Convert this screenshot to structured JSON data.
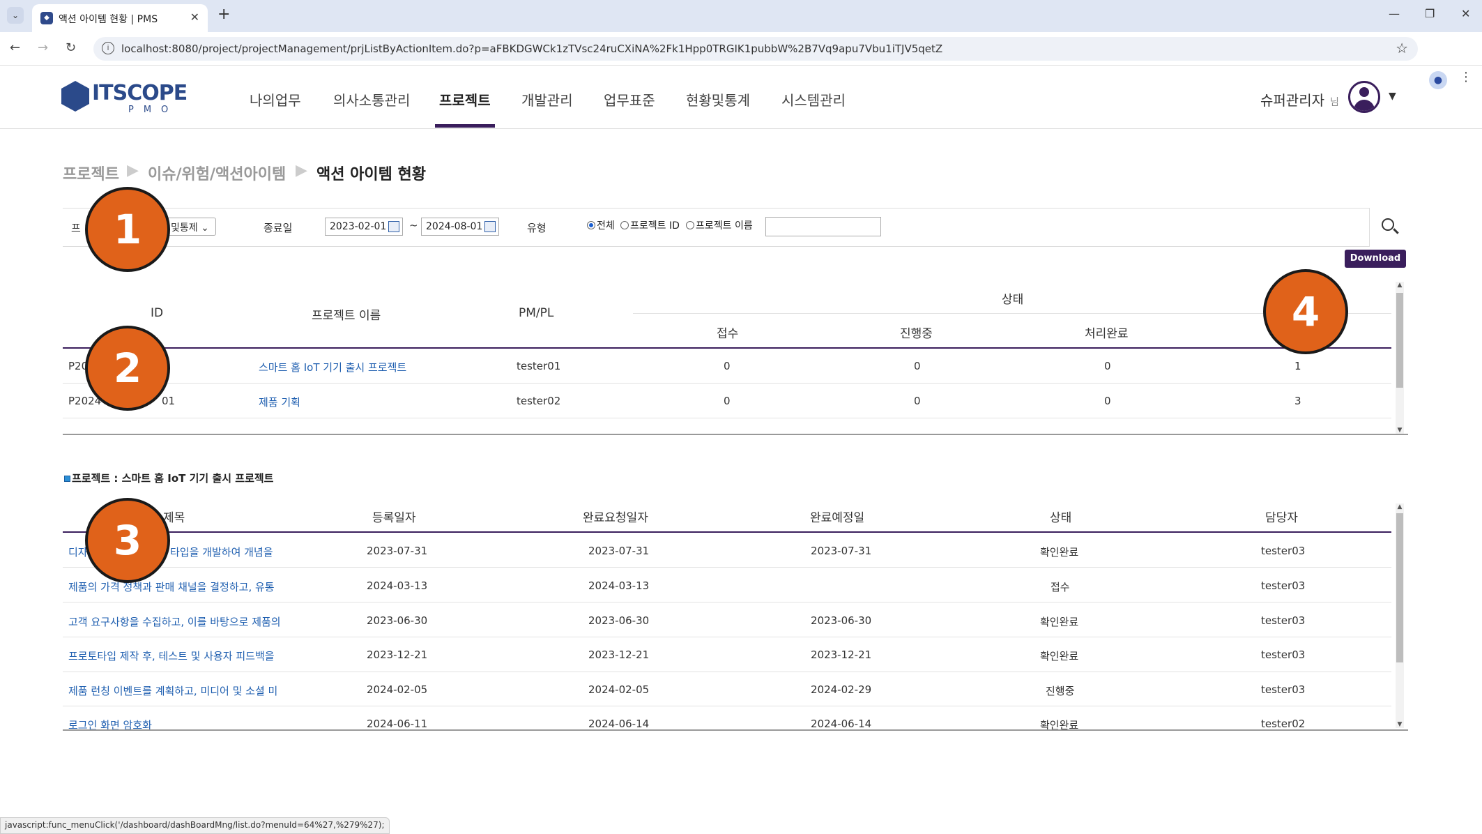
{
  "browser": {
    "tab_title": "액션 아이템 현황 | PMS",
    "url": "localhost:8080/project/projectManagement/prjListByActionItem.do?p=aFBKDGWCk1zTVsc24ruCXiNA%2Fk1Hpp0TRGIK1pubbW%2B7Vq9apu7Vbu1iTJV5qetZ",
    "status_url": "javascript:func_menuClick('/dashboard/dashBoardMng/list.do?menuId=64%27,%279%27);"
  },
  "header": {
    "logo_text": "ITSCOPE",
    "logo_sub": "PMO",
    "menu": [
      "나의업무",
      "의사소통관리",
      "프로젝트",
      "개발관리",
      "업무표준",
      "현황및통계",
      "시스템관리"
    ],
    "active_menu": "프로젝트",
    "user_name": "슈퍼관리자",
    "user_suffix": "님"
  },
  "breadcrumb": [
    "프로젝트",
    "이슈/위험/액션아이템",
    "액션 아이템 현황"
  ],
  "filter": {
    "project_label": "프",
    "project_select": "및통제",
    "end_date_label": "종료일",
    "date_from": "2023-02-01",
    "date_sep": "~",
    "date_to": "2024-08-01",
    "type_label": "유형",
    "radios": [
      {
        "label": "전체",
        "checked": true
      },
      {
        "label": "프로젝트 ID",
        "checked": false
      },
      {
        "label": "프로젝트 이름",
        "checked": false
      }
    ],
    "search_value": "",
    "download_label": "Download"
  },
  "project_grid": {
    "headers": {
      "id": "ID",
      "name": "프로젝트 이름",
      "pm": "PM/PL",
      "status": "상태",
      "received": "접수",
      "progress": "진행중",
      "done": "처리완료"
    },
    "rows": [
      {
        "id": "P20",
        "name": "스마트 홈 IoT 기기 출시 프로젝트",
        "pm": "tester01",
        "received": "0",
        "progress": "0",
        "done": "0",
        "last": "1"
      },
      {
        "id": "P2024",
        "id_tail": "01",
        "name": "제품 기획",
        "pm": "tester02",
        "received": "0",
        "progress": "0",
        "done": "0",
        "last": "3"
      }
    ]
  },
  "section_title": "프로젝트 : 스마트 홈 IoT 기기 출시 프로젝트",
  "action_grid": {
    "headers": [
      "제목",
      "등록일자",
      "완료요청일자",
      "완료예정일",
      "상태",
      "담당자"
    ],
    "rows": [
      {
        "title_a": "디자",
        "title_b": "타입을 개발하여 개념을",
        "reg": "2023-07-31",
        "req": "2023-07-31",
        "plan": "2023-07-31",
        "status": "확인완료",
        "owner": "tester03"
      },
      {
        "title": "제품의 가격 정책과 판매 채널을 결정하고, 유통",
        "reg": "2024-03-13",
        "req": "2024-03-13",
        "plan": "",
        "status": "접수",
        "owner": "tester03"
      },
      {
        "title": "고객 요구사항을 수집하고, 이를 바탕으로 제품의",
        "reg": "2023-06-30",
        "req": "2023-06-30",
        "plan": "2023-06-30",
        "status": "확인완료",
        "owner": "tester03"
      },
      {
        "title": "프로토타입 제작 후, 테스트 및 사용자 피드백을",
        "reg": "2023-12-21",
        "req": "2023-12-21",
        "plan": "2023-12-21",
        "status": "확인완료",
        "owner": "tester03"
      },
      {
        "title": "제품 런칭 이벤트를 계획하고, 미디어 및 소셜 미",
        "reg": "2024-02-05",
        "req": "2024-02-05",
        "plan": "2024-02-29",
        "status": "진행중",
        "owner": "tester03"
      },
      {
        "title": "로그인 화면 암호화",
        "reg": "2024-06-11",
        "req": "2024-06-14",
        "plan": "2024-06-14",
        "status": "확인완료",
        "owner": "tester02"
      }
    ]
  },
  "markers": [
    "1",
    "2",
    "3",
    "4"
  ],
  "colors": {
    "accent": "#3a1e5c",
    "marker": "#e0621a",
    "link": "#1f5fb0"
  }
}
